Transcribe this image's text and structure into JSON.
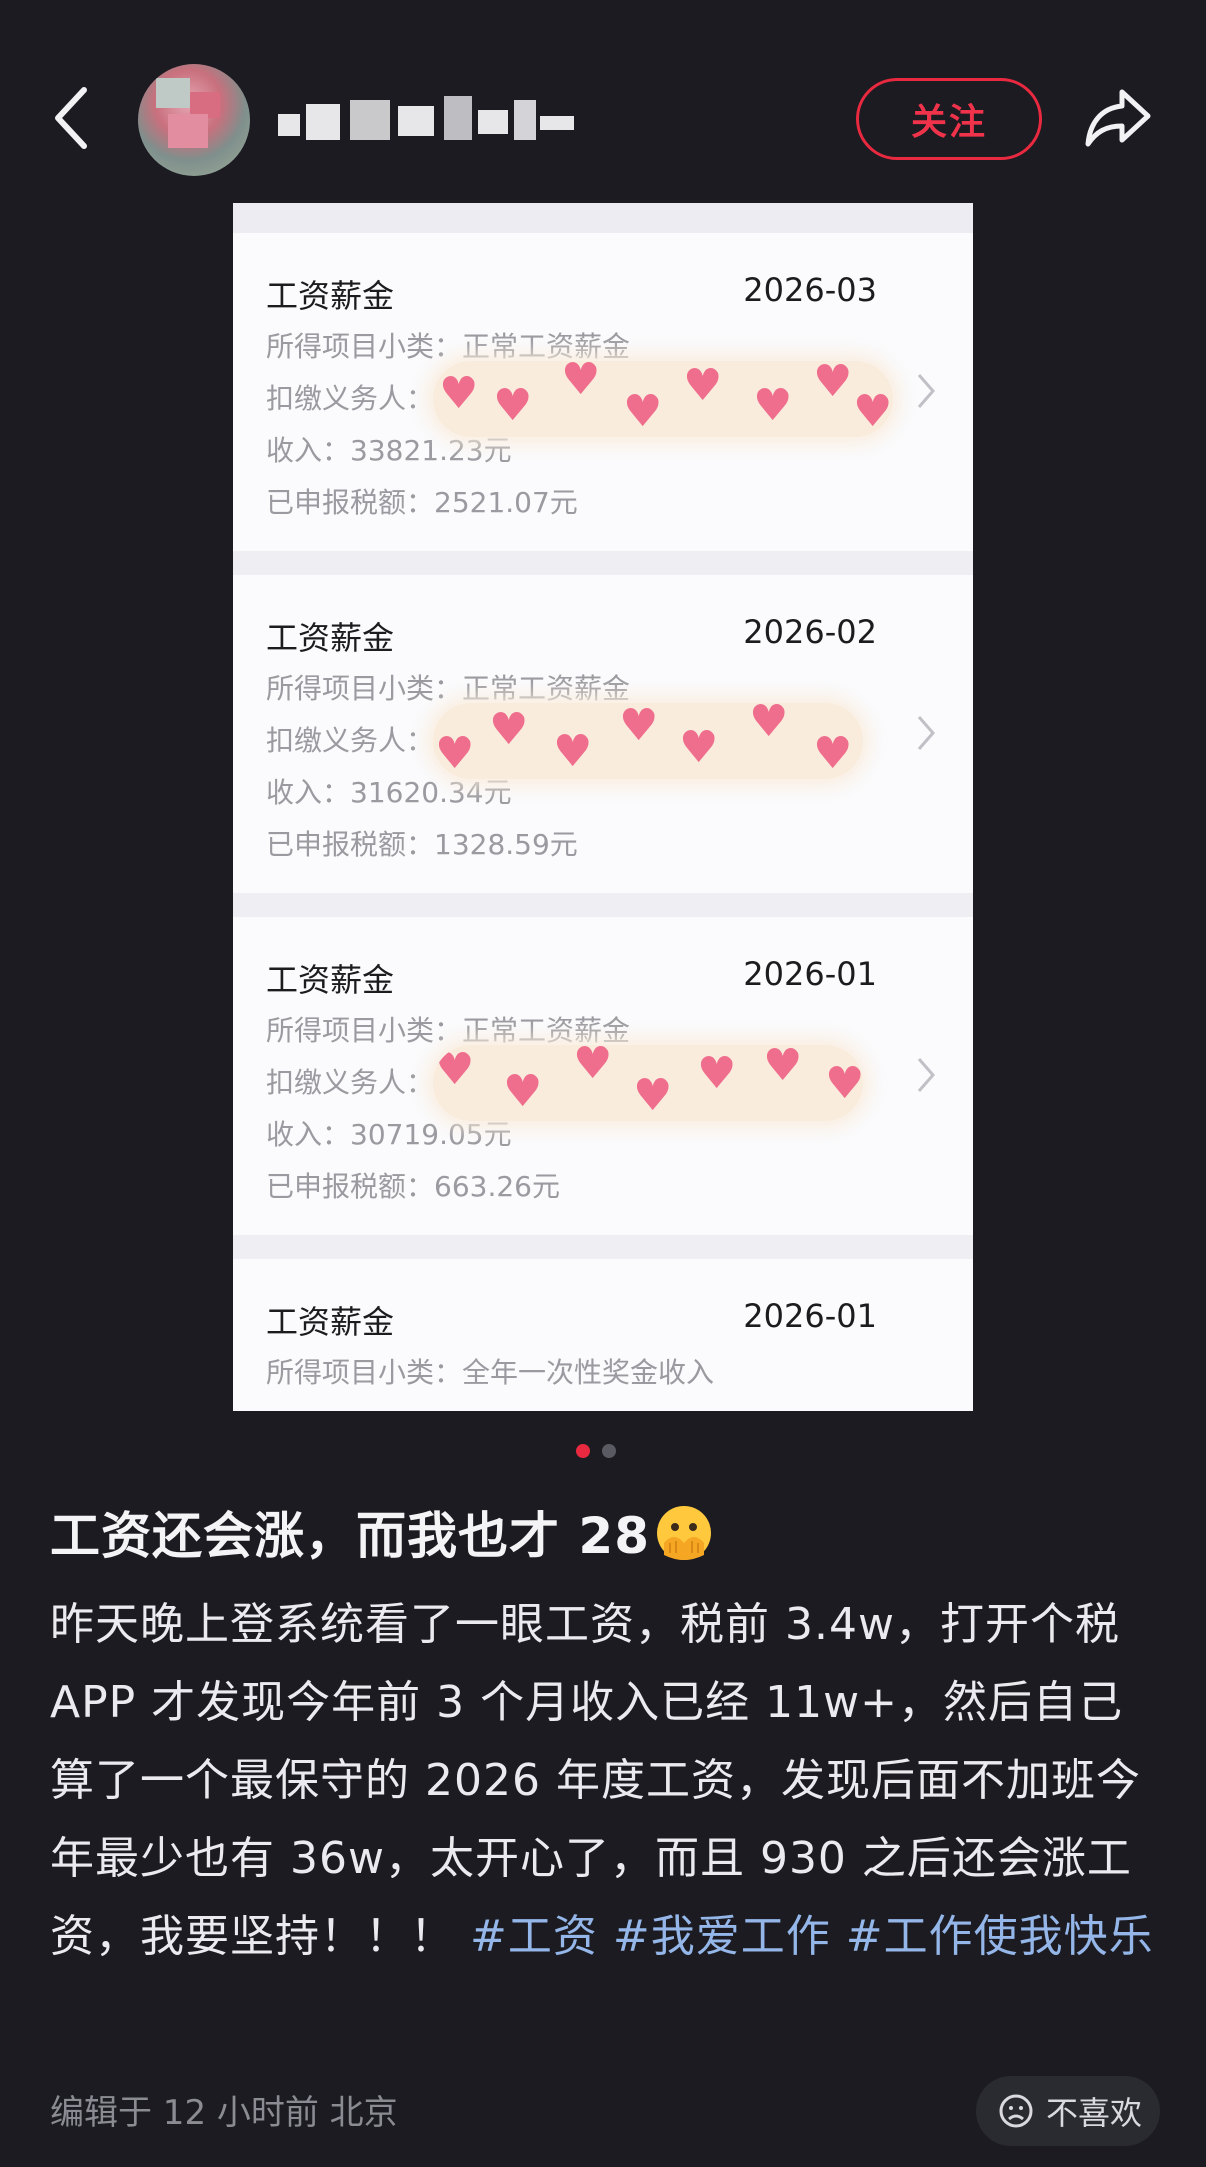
{
  "header": {
    "follow_label": "关注",
    "icons": [
      "back-icon",
      "share-icon"
    ]
  },
  "records": [
    {
      "title": "工资薪金",
      "date": "2026-03",
      "subcategory": "所得项目小类：正常工资薪金",
      "payer_label": "扣缴义务人：",
      "income": "收入：33821.23元",
      "tax": "已申报税额：2521.07元"
    },
    {
      "title": "工资薪金",
      "date": "2026-02",
      "subcategory": "所得项目小类：正常工资薪金",
      "payer_label": "扣缴义务人：",
      "income": "收入：31620.34元",
      "tax": "已申报税额：1328.59元"
    },
    {
      "title": "工资薪金",
      "date": "2026-01",
      "subcategory": "所得项目小类：正常工资薪金",
      "payer_label": "扣缴义务人：",
      "income": "收入：30719.05元",
      "tax": "已申报税额：663.26元"
    },
    {
      "title": "工资薪金",
      "date": "2026-01",
      "subcategory": "所得项目小类：全年一次性奖金收入"
    }
  ],
  "carousel": {
    "active_color": "#e8293f",
    "inactive_color": "#5a5a62"
  },
  "post": {
    "title": "工资还会涨，而我也才 28",
    "body": "昨天晚上登系统看了一眼工资，税前 3.4w，打开个税 APP 才发现今年前 3 个月收入已经 11w+，然后自己算了一个最保守的 2026 年度工资，发现后面不加班今年最少也有 36w，太开心了，而且 930 之后还会涨工资，我要坚持！！！",
    "tags": [
      "#工资",
      "#我爱工作",
      "#工作使我快乐"
    ],
    "meta": "编辑于 12 小时前 北京",
    "dislike_label": "不喜欢"
  },
  "colors": {
    "background": "#1b1b21",
    "accent": "#e8293f",
    "tag": "#94b6e8"
  }
}
